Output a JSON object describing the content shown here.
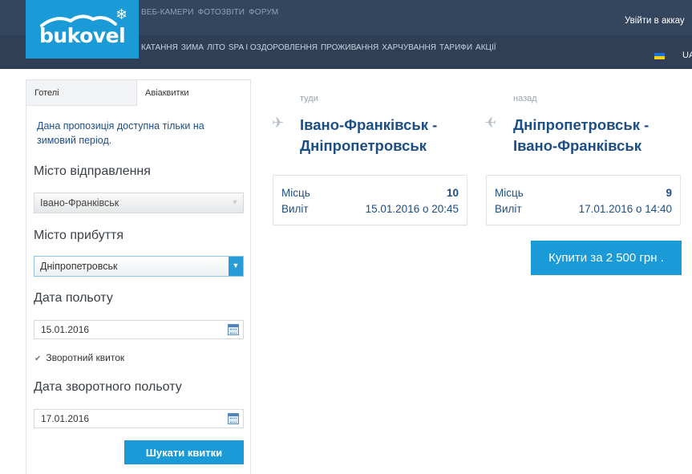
{
  "header": {
    "logo_text": "bukovel",
    "top_nav": [
      "ВЕБ-КАМЕРИ",
      "ФОТОЗВІТИ",
      "ФОРУМ"
    ],
    "main_nav": [
      "КАТАННЯ",
      "ЗИМА",
      "ЛІТО",
      "SPA І ОЗДОРОВЛЕННЯ",
      "ПРОЖИВАННЯ",
      "ХАРЧУВАННЯ",
      "ТАРИФИ",
      "АКЦІЇ"
    ],
    "login": "Увійти в аккау",
    "lang": "UA"
  },
  "search_panel": {
    "tabs": [
      "Готелі",
      "Авіаквитки"
    ],
    "notice": "Дана пропозиція доступна тільки на зимовий період.",
    "departure_label": "Місто відправлення",
    "departure_value": "Івано-Франківськ",
    "arrival_label": "Місто прибуття",
    "arrival_value": "Дніпропетровськ",
    "date_label": "Дата польоту",
    "date_value": "15.01.2016",
    "return_checkbox": "Зворотний квиток",
    "return_date_label": "Дата зворотного польоту",
    "return_date_value": "17.01.2016",
    "search_button": "Шукати квитки"
  },
  "flights": {
    "outbound": {
      "direction": "туди",
      "route_line1": "Івано-Франківськ -",
      "route_line2": "Дніпропетровськ",
      "seats_label": "Місць",
      "seats": "10",
      "departure_label": "Виліт",
      "departure": "15.01.2016 о 20:45"
    },
    "return": {
      "direction": "назад",
      "route_line1": "Дніпропетровськ -",
      "route_line2": "Івано-Франківськ",
      "seats_label": "Місць",
      "seats": "9",
      "departure_label": "Виліт",
      "departure": "17.01.2016 о 14:40"
    },
    "buy_button": "Купити за 2 500 грн ."
  },
  "colors": {
    "header": "#34465e",
    "brand_blue": "#1a9ad6",
    "text_blue": "#1d4e84"
  },
  "icons": [
    "snowflake-icon",
    "mountain-icon",
    "ukraine-flag-icon",
    "plane-outbound-icon",
    "plane-return-icon",
    "calendar-icon",
    "checkmark-icon",
    "dropdown-arrow-icon"
  ]
}
